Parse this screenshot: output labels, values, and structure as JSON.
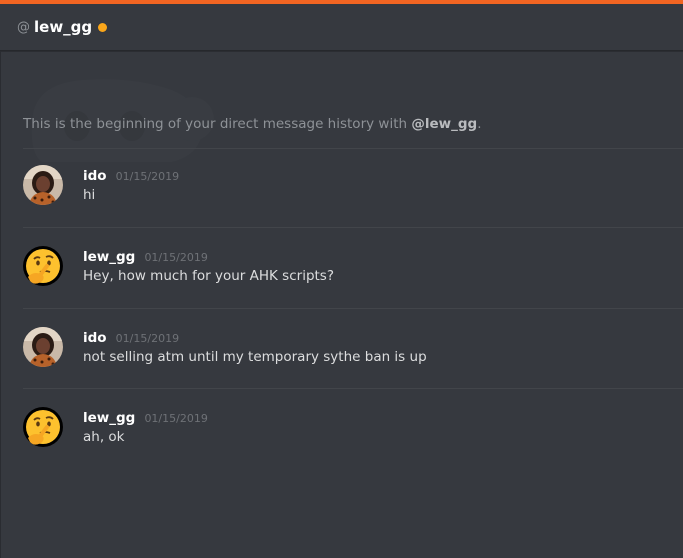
{
  "header": {
    "at_symbol": "@",
    "username": "lew_gg",
    "status_color": "#faa61a",
    "status": "idle"
  },
  "accent_color": "#f26522",
  "intro": {
    "prefix": "This is the beginning of your direct message history with ",
    "mention": "@lew_gg",
    "suffix": "."
  },
  "messages": [
    {
      "author": "ido",
      "timestamp": "01/15/2019",
      "text": "hi",
      "avatar": "ido-avatar"
    },
    {
      "author": "lew_gg",
      "timestamp": "01/15/2019",
      "text": "Hey, how much for your AHK scripts?",
      "avatar": "thinking-face-avatar"
    },
    {
      "author": "ido",
      "timestamp": "01/15/2019",
      "text": "not selling atm until my temporary sythe ban is up",
      "avatar": "ido-avatar"
    },
    {
      "author": "lew_gg",
      "timestamp": "01/15/2019",
      "text": "ah, ok",
      "avatar": "thinking-face-avatar"
    }
  ]
}
